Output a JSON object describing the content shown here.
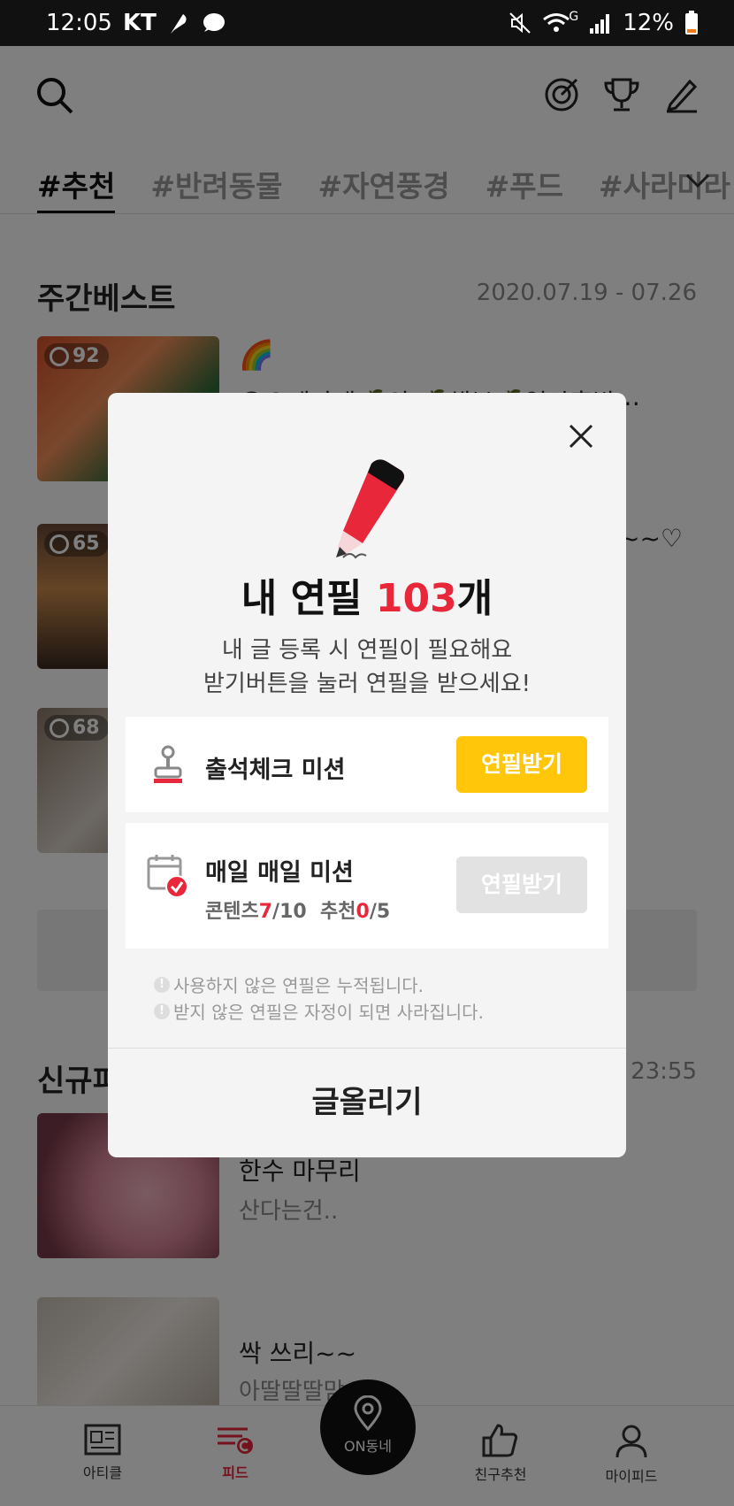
{
  "status_bar": {
    "time": "12:05",
    "carrier": "KT",
    "network": "G",
    "battery": "12%"
  },
  "tabs": [
    {
      "label": "#추천",
      "active": true
    },
    {
      "label": "#반려동물",
      "active": false
    },
    {
      "label": "#자연풍경",
      "active": false
    },
    {
      "label": "#푸드",
      "active": false
    },
    {
      "label": "#사라미라",
      "active": false
    }
  ],
  "weekly_best": {
    "title": "주간베스트",
    "date_range": "2020.07.19 - 07.26",
    "items": [
      {
        "count": "92",
        "text": "😊오레가네🍊의 🍊해부🍊열아홉밥⋯",
        "emoji": "🌈"
      },
      {
        "count": "65",
        "text": "~~♡"
      },
      {
        "count": "68",
        "text": ""
      }
    ]
  },
  "new_feed": {
    "title": "신규피",
    "time": "23:55",
    "items": [
      {
        "title": "한수 마무리",
        "sub": "산다는건.."
      },
      {
        "title": "싹 쓰리~~",
        "sub": "아딸딸딸맘"
      }
    ]
  },
  "bottom_nav": {
    "article": "아티클",
    "feed": "피드",
    "neighborhood": "ON동네",
    "friend": "친구추천",
    "my_feed": "마이피드"
  },
  "modal": {
    "title_prefix": "내 연필 ",
    "pencil_count": "103",
    "title_suffix": "개",
    "desc_line1": "내 글 등록 시 연필이 필요해요",
    "desc_line2": "받기버튼을 눌러 연필을 받으세요!",
    "mission1": {
      "name": "출석체크 미션",
      "button": "연필받기"
    },
    "mission2": {
      "name": "매일 매일 미션",
      "content_label": "콘텐츠",
      "content_done": "7",
      "content_total": "/10",
      "rec_label": "추천",
      "rec_done": "0",
      "rec_total": "/5",
      "button": "연필받기"
    },
    "note1": "사용하지 않은 연필은 누적됩니다.",
    "note2": "받지 않은 연필은 자정이 되면 사라집니다.",
    "post_button": "글올리기"
  },
  "colors": {
    "accent_red": "#e8273a",
    "button_yellow": "#ffc60a",
    "button_disabled": "#e2e2e2"
  }
}
